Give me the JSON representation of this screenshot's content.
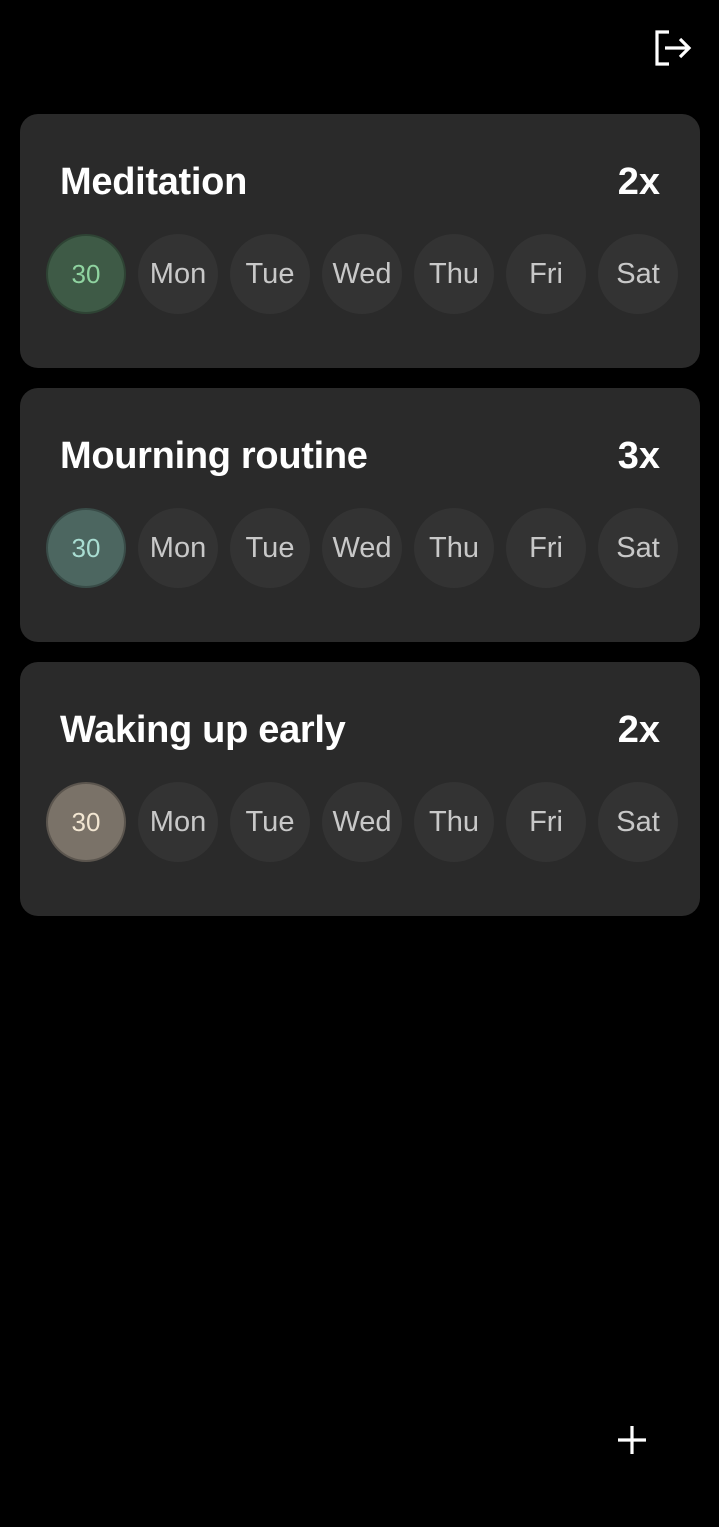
{
  "header": {
    "logout_icon": "logout-icon"
  },
  "habits": [
    {
      "title": "Meditation",
      "count": "2x",
      "today_label": "30",
      "today_bg": "#3e5a46",
      "today_fg": "#8fd3a0",
      "days": [
        "Mon",
        "Tue",
        "Wed",
        "Thu",
        "Fri",
        "Sat"
      ]
    },
    {
      "title": "Mourning routine",
      "count": "3x",
      "today_label": "30",
      "today_bg": "#4c6660",
      "today_fg": "#a9ddd2",
      "days": [
        "Mon",
        "Tue",
        "Wed",
        "Thu",
        "Fri",
        "Sat"
      ]
    },
    {
      "title": "Waking up early",
      "count": "2x",
      "today_label": "30",
      "today_bg": "#7a7268",
      "today_fg": "#f2e6d2",
      "days": [
        "Mon",
        "Tue",
        "Wed",
        "Thu",
        "Fri",
        "Sat"
      ]
    }
  ],
  "fab": {
    "icon": "plus-icon"
  },
  "colors": {
    "background": "#000000",
    "card": "#2a2a2a",
    "day_circle": "#333333",
    "day_text": "#c8c8c8"
  }
}
